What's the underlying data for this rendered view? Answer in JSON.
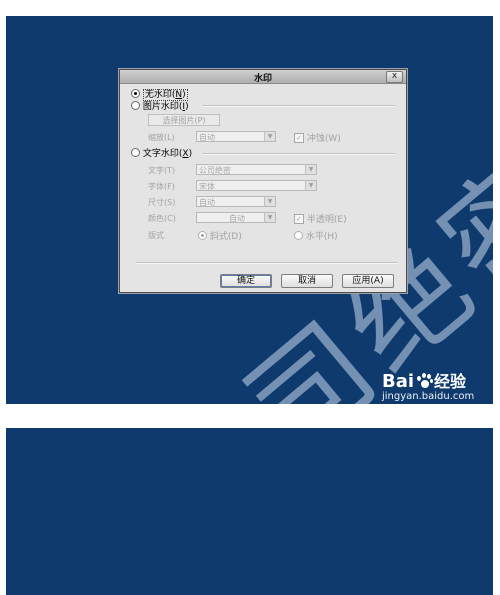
{
  "watermark_text": "公司绝密",
  "dialog": {
    "title": "水印",
    "close_label": "x",
    "options": {
      "none": "无水印",
      "none_key": "N",
      "picture": "图片水印",
      "picture_key": "I",
      "text": "文字水印",
      "text_key": "X"
    },
    "picture": {
      "select_button": "选择图片(P)",
      "scale_label": "缩放(L)",
      "scale_value": "自动",
      "washout_label": "冲蚀(W)"
    },
    "text_settings": {
      "text_label": "文字(T)",
      "text_value": "公司绝密",
      "font_label": "字体(F)",
      "font_value": "宋体",
      "size_label": "尺寸(S)",
      "size_value": "自动",
      "color_label": "颜色(C)",
      "color_value": "自动",
      "semitransparent_label": "半透明(E)",
      "layout_label": "版式",
      "diagonal_label": "斜式(D)",
      "horizontal_label": "水平(H)"
    },
    "buttons": {
      "ok": "确定",
      "cancel": "取消",
      "apply": "应用(A)"
    }
  },
  "baidu": {
    "brand_left": "Bai",
    "brand_right": "经验",
    "url": "jingyan.baidu.com"
  },
  "colors": {
    "background": "#0f3a6e",
    "dialog": "#e4e4e4"
  }
}
